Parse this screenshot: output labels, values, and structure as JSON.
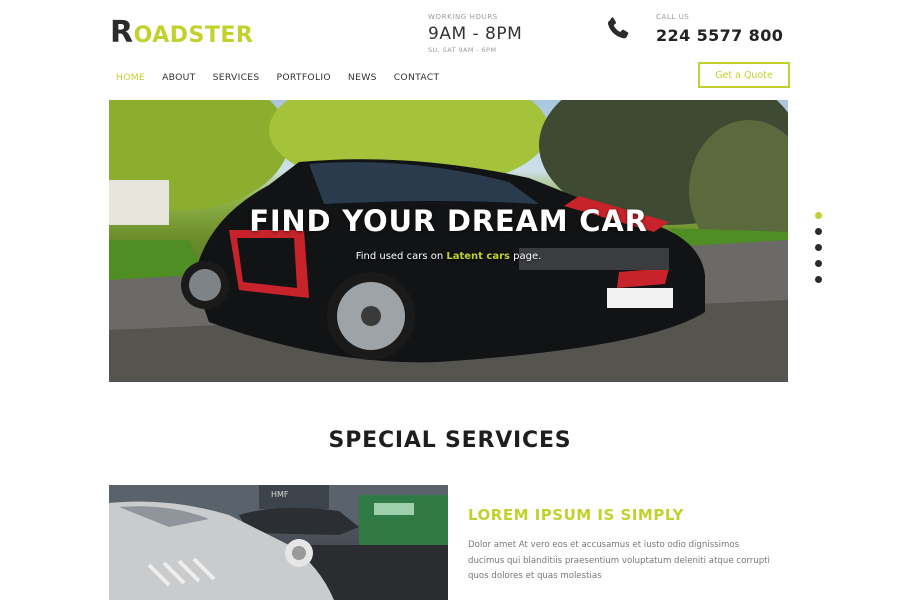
{
  "logo": {
    "first": "R",
    "rest": "OADSTER"
  },
  "contact": {
    "hours_label": "WORKING HOURS",
    "hours_value": "9AM - 8PM",
    "hours_sub": "SU, SAT 9AM - 6PM",
    "call_label": "CALL US",
    "phone": "224 5577 800"
  },
  "nav": {
    "items": [
      {
        "label": "HOME",
        "active": true
      },
      {
        "label": "ABOUT"
      },
      {
        "label": "SERVICES"
      },
      {
        "label": "PORTFOLIO"
      },
      {
        "label": "NEWS"
      },
      {
        "label": "CONTACT"
      }
    ]
  },
  "quote_button": "Get a Quote",
  "hero": {
    "title": "FIND YOUR DREAM CAR",
    "subtitle_pre": "Find used cars on ",
    "subtitle_highlight": "Latent cars",
    "subtitle_post": " page."
  },
  "slider": {
    "count": 5,
    "active_index": 0
  },
  "section": {
    "title": "SPECIAL SERVICES"
  },
  "service": {
    "title": "LOREM IPSUM IS SIMPLY",
    "text": "Dolor amet At vero eos et accusamus et iusto odio dignissimos ducimus qui blanditiis praesentium voluptatum deleniti atque corrupti quos dolores et quas molestias"
  },
  "colors": {
    "accent": "#c3d12f",
    "text": "#222222",
    "muted": "#9a9a9a"
  },
  "icons": {
    "phone": "phone-icon"
  }
}
